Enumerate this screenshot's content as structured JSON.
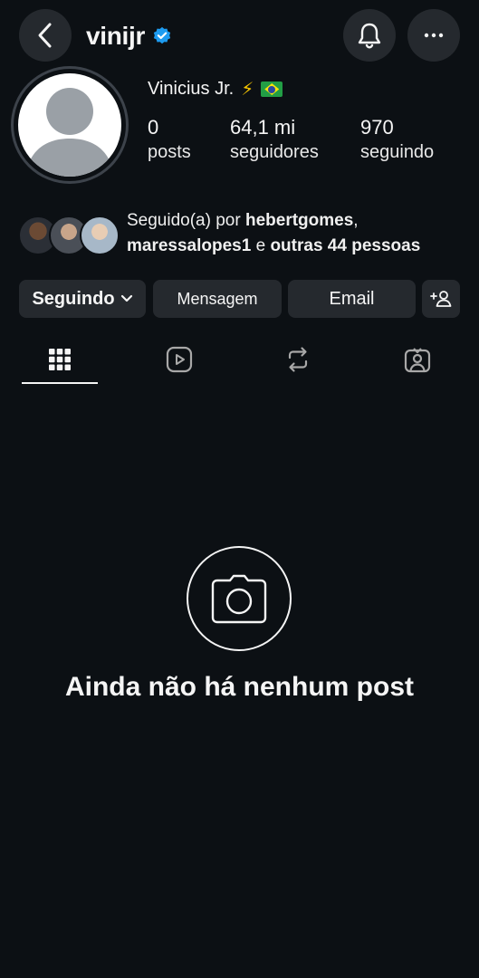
{
  "header": {
    "username": "vinijr",
    "back_icon": "chevron-left-icon",
    "notifications_icon": "bell-icon",
    "more_icon": "ellipsis-icon",
    "verified_icon": "verified-badge-icon",
    "verified_color": "#1d9bf0"
  },
  "profile": {
    "display_name": "Vinicius Jr.",
    "emoji_bolt": "⚡",
    "flag_icon": "brazil-flag-icon",
    "stats": [
      {
        "value": "0",
        "label": "posts"
      },
      {
        "value": "64,1 mi",
        "label": "seguidores"
      },
      {
        "value": "970",
        "label": "seguindo"
      }
    ]
  },
  "followed_by": {
    "prefix": "Seguido(a) por ",
    "user1": "hebertgomes",
    "comma": ",",
    "user2": "maressalopes1",
    "connector": " e ",
    "others": "outras 44 pessoas"
  },
  "actions": {
    "following_label": "Seguindo",
    "message_label": "Mensagem",
    "email_label": "Email",
    "add_user_icon": "add-user-icon"
  },
  "tabs": [
    {
      "icon": "grid-icon",
      "active": true
    },
    {
      "icon": "reels-icon",
      "active": false
    },
    {
      "icon": "repost-icon",
      "active": false
    },
    {
      "icon": "tagged-icon",
      "active": false
    }
  ],
  "empty_state": {
    "icon": "camera-icon",
    "message": "Ainda não há nenhum post"
  },
  "colors": {
    "background": "#0c1014",
    "button_bg": "#25292e",
    "text": "#f5f5f5"
  }
}
